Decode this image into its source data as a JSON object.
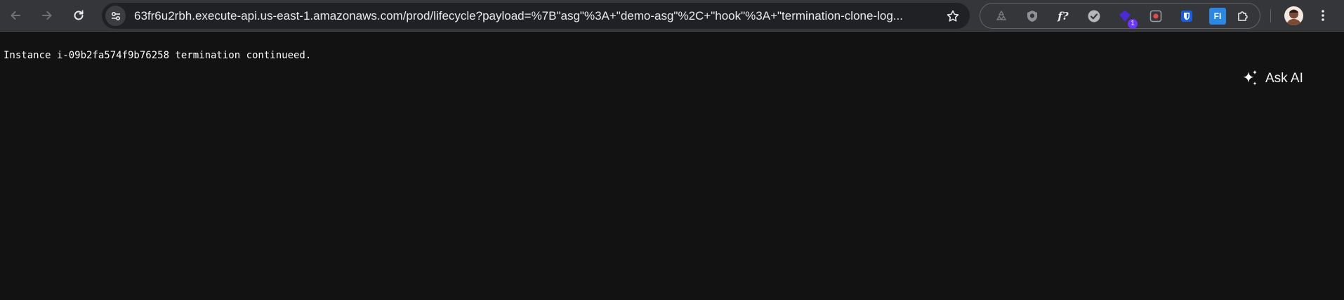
{
  "browser": {
    "nav": {
      "back_icon": "arrow-left-icon",
      "forward_icon": "arrow-right-icon",
      "reload_icon": "reload-icon"
    },
    "address_bar": {
      "site_info_icon": "tune-icon",
      "url": "63fr6u2rbh.execute-api.us-east-1.amazonaws.com/prod/lifecycle?payload=%7B\"asg\"%3A+\"demo-asg\"%2C+\"hook\"%3A+\"termination-clone-log...",
      "bookmark_icon": "star-icon"
    },
    "extensions": [
      {
        "name": "recycle-extension-icon"
      },
      {
        "name": "shield-extension-icon"
      },
      {
        "name": "function-extension-icon",
        "label": "f?"
      },
      {
        "name": "checkmark-extension-icon"
      },
      {
        "name": "purple-extension-icon",
        "badge": "1"
      },
      {
        "name": "record-extension-icon"
      },
      {
        "name": "bitwarden-extension-icon"
      },
      {
        "name": "fi-extension-icon",
        "label": "FI"
      },
      {
        "name": "puzzle-extensions-icon"
      }
    ],
    "accent_color": "#6a35ff"
  },
  "page": {
    "message": "Instance i-09b2fa574f9b76258 termination continueed.",
    "ask_ai": {
      "label": "Ask AI",
      "icon": "sparkle-icon"
    },
    "background": "#121212"
  }
}
